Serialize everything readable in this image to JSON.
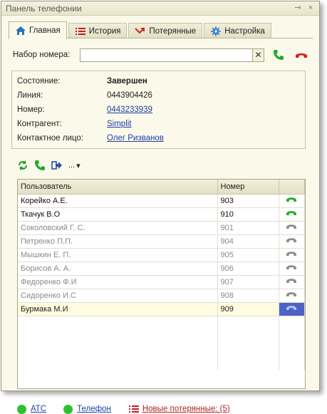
{
  "window": {
    "title": "Панель телефонии"
  },
  "tabs": [
    {
      "label": "Главная",
      "icon": "home-icon"
    },
    {
      "label": "История",
      "icon": "list-icon"
    },
    {
      "label": "Потерянные",
      "icon": "missed-call-icon"
    },
    {
      "label": "Настройка",
      "icon": "gear-icon"
    }
  ],
  "dial": {
    "label": "Набор номера:",
    "value": "",
    "placeholder": ""
  },
  "info": {
    "state_label": "Состояние:",
    "state_value": "Завершен",
    "line_label": "Линия:",
    "line_value": "0443904426",
    "number_label": "Номер:",
    "number_value": "0443233939",
    "contractor_label": "Контрагент:",
    "contractor_value": "Simplit",
    "contact_label": "Контактное лицо:",
    "contact_value": "Олег Ризванов"
  },
  "toolbar": {
    "more_label": "..."
  },
  "grid": {
    "columns": [
      "Пользователь",
      "Номер",
      ""
    ],
    "rows": [
      {
        "user": "Корейко А.Е.",
        "number": "903",
        "status": "active"
      },
      {
        "user": "Ткачук В.О",
        "number": "910",
        "status": "active"
      },
      {
        "user": "Соколовский Г. С.",
        "number": "901",
        "status": "inactive"
      },
      {
        "user": "Петренко П.П.",
        "number": "904",
        "status": "inactive"
      },
      {
        "user": "Мышкин Е. П.",
        "number": "905",
        "status": "inactive"
      },
      {
        "user": "Борисов А. А.",
        "number": "906",
        "status": "inactive"
      },
      {
        "user": "Федоренко Ф.И",
        "number": "907",
        "status": "inactive"
      },
      {
        "user": "Сидоренко И.С",
        "number": "908",
        "status": "inactive"
      },
      {
        "user": "Бурмака М.И",
        "number": "909",
        "status": "selected"
      }
    ]
  },
  "footer": {
    "ats_label": "АТС",
    "phone_label": "Телефон",
    "missed_label": "Новые потерянные: (5)"
  },
  "colors": {
    "green": "#2fc02f",
    "red": "#d42020",
    "selected": "#4d63c6",
    "panel": "#fbf9ea"
  }
}
